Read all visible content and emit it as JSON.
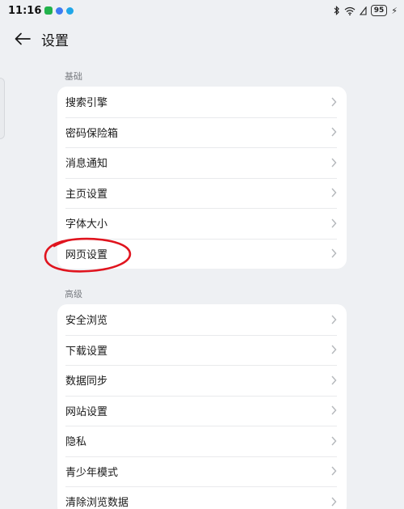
{
  "status_bar": {
    "time": "11:16",
    "battery": "95"
  },
  "header": {
    "title": "设置"
  },
  "sections": [
    {
      "label": "基础",
      "items": [
        {
          "label": "搜索引擎"
        },
        {
          "label": "密码保险箱"
        },
        {
          "label": "消息通知"
        },
        {
          "label": "主页设置"
        },
        {
          "label": "字体大小"
        },
        {
          "label": "网页设置"
        }
      ]
    },
    {
      "label": "高级",
      "items": [
        {
          "label": "安全浏览"
        },
        {
          "label": "下载设置"
        },
        {
          "label": "数据同步"
        },
        {
          "label": "网站设置"
        },
        {
          "label": "隐私"
        },
        {
          "label": "青少年模式"
        },
        {
          "label": "清除浏览数据"
        }
      ]
    }
  ],
  "colors": {
    "background": "#eef0f3",
    "card": "#ffffff",
    "annotation": "#e0141e"
  }
}
